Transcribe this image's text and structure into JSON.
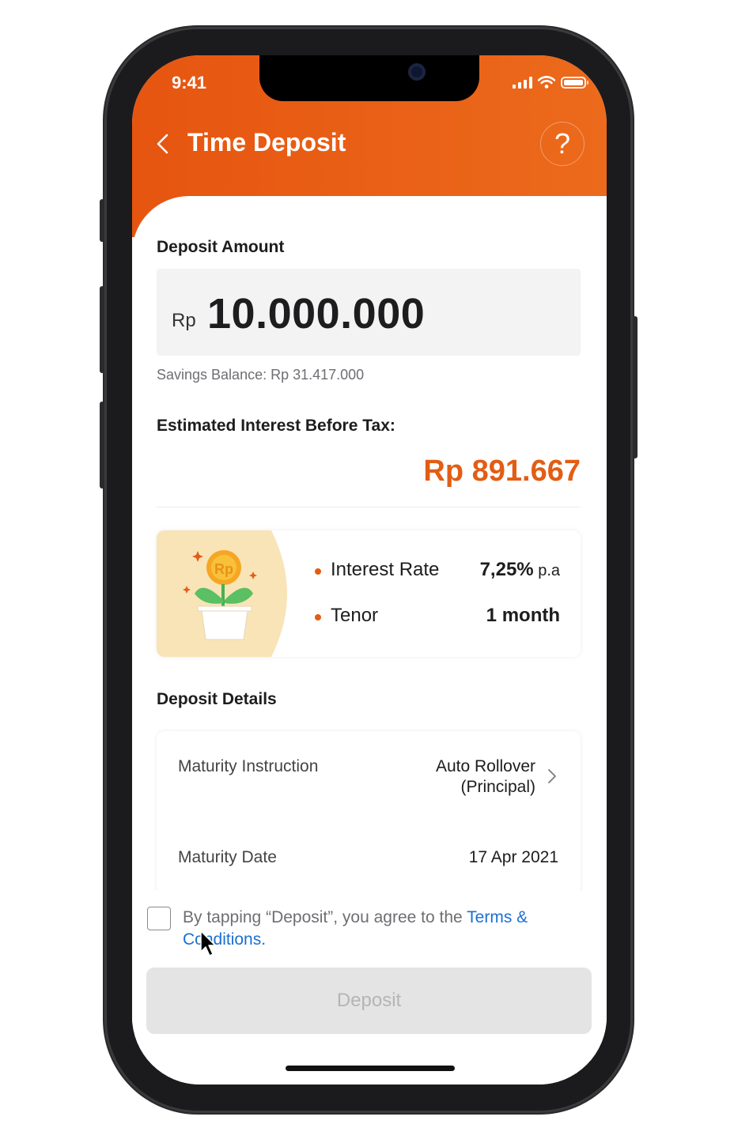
{
  "status_bar": {
    "time": "9:41"
  },
  "header": {
    "title": "Time Deposit",
    "help_label": "?"
  },
  "deposit_amount": {
    "label": "Deposit Amount",
    "currency": "Rp",
    "value": "10.000.000",
    "savings_balance": "Savings Balance: Rp 31.417.000"
  },
  "interest": {
    "label": "Estimated Interest Before Tax:",
    "value": "Rp 891.667"
  },
  "rate_card": {
    "coin_text": "Rp",
    "rows": [
      {
        "label": "Interest Rate",
        "value": "7,25%",
        "suffix": " p.a"
      },
      {
        "label": "Tenor",
        "value": "1 month"
      }
    ]
  },
  "details": {
    "title": "Deposit Details",
    "maturity_instruction": {
      "label": "Maturity Instruction",
      "value_line1": "Auto Rollover",
      "value_line2": "(Principal)"
    },
    "maturity_date": {
      "label": "Maturity Date",
      "value": "17 Apr 2021"
    }
  },
  "agreement": {
    "text": "By tapping “Deposit”, you agree to the ",
    "link": "Terms & Conditions",
    "end": "."
  },
  "deposit_button": {
    "label": "Deposit"
  },
  "colors": {
    "accent": "#e65510",
    "interest": "#e25d14",
    "link": "#1b6fd1"
  },
  "icons": [
    "back-icon",
    "help-icon",
    "signal-icon",
    "wifi-icon",
    "battery-icon",
    "plant-coin-illustration",
    "chevron-right-icon",
    "cursor-icon"
  ]
}
